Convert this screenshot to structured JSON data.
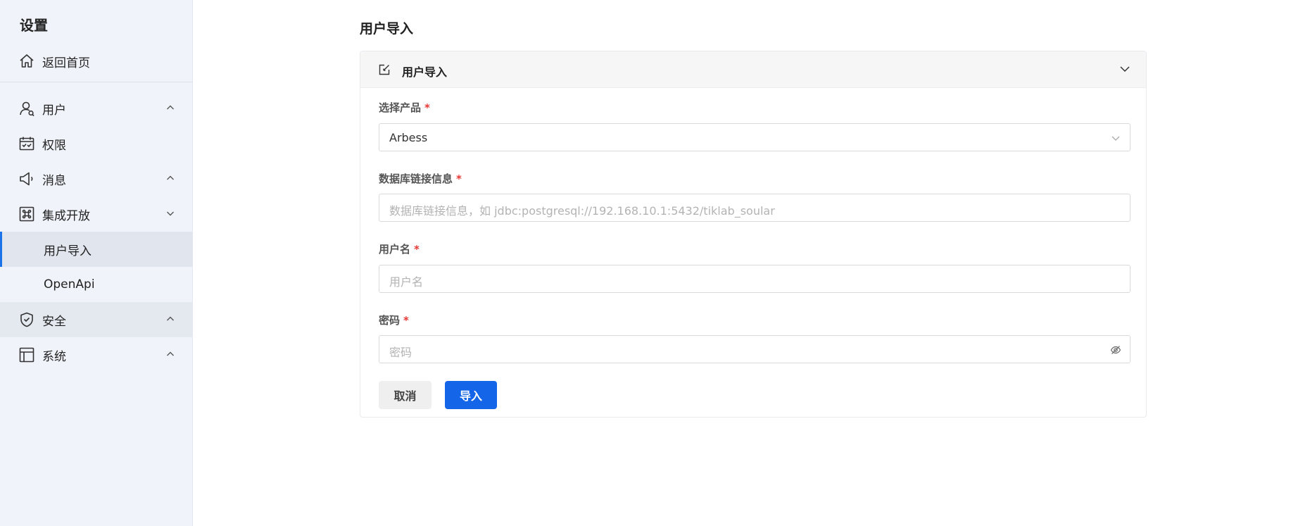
{
  "sidebar": {
    "title": "设置",
    "home": {
      "label": "返回首页",
      "icon": "home-icon"
    },
    "items": [
      {
        "label": "用户",
        "icon": "user-icon",
        "chevron": "up"
      },
      {
        "label": "权限",
        "icon": "calendar-check-icon"
      },
      {
        "label": "消息",
        "icon": "megaphone-icon",
        "chevron": "up"
      },
      {
        "label": "集成开放",
        "icon": "command-icon",
        "chevron": "down"
      },
      {
        "label": "用户导入",
        "active": true
      },
      {
        "label": "OpenApi"
      },
      {
        "label": "安全",
        "icon": "shield-check-icon",
        "chevron": "up"
      },
      {
        "label": "系统",
        "icon": "layout-icon",
        "chevron": "up"
      }
    ]
  },
  "main": {
    "page_title": "用户导入",
    "card": {
      "title": "用户导入",
      "icon": "edit-square-icon",
      "collapse_icon": "chevron-down-icon",
      "fields": [
        {
          "label": "选择产品",
          "required_mark": "*",
          "value": "Arbess",
          "suffix_icon": "chevron-down-icon"
        },
        {
          "label": "数据库链接信息",
          "required_mark": "*",
          "placeholder": "数据库链接信息，如 jdbc:postgresql://192.168.10.1:5432/tiklab_soular"
        },
        {
          "label": "用户名",
          "required_mark": "*",
          "placeholder": "用户名"
        },
        {
          "label": "密码",
          "required_mark": "*",
          "placeholder": "密码",
          "suffix_icon": "eye-off-icon"
        }
      ],
      "cancel_label": "取消",
      "import_label": "导入"
    }
  },
  "colors": {
    "primary": "#1565e8",
    "sidebar_bg": "#f0f3f9",
    "required": "#e53935"
  }
}
